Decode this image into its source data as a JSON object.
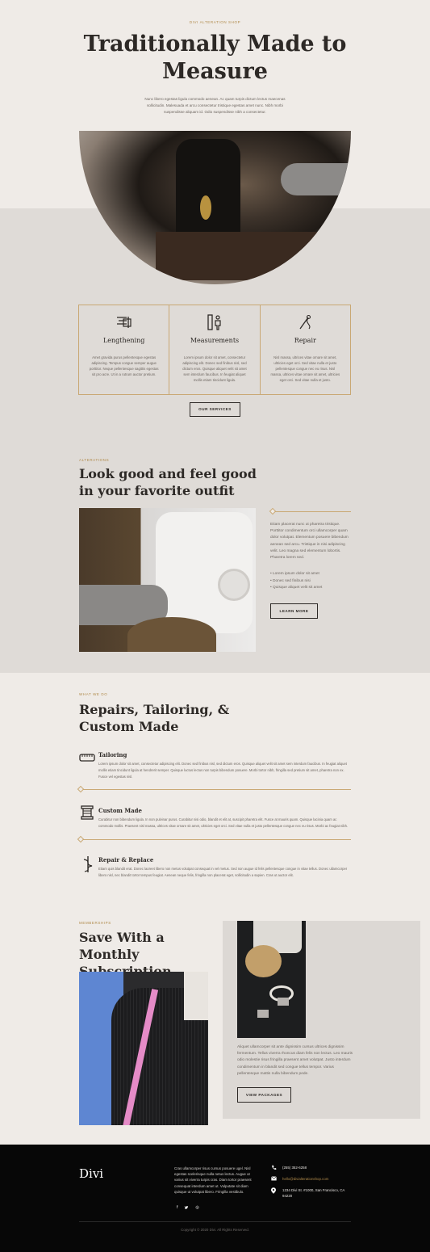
{
  "hero": {
    "eyebrow": "DIVI ALTERATION SHOP",
    "title": "Traditionally Made to Measure",
    "text": "Nunc libero egestas ligula commodo aenean. Ac quam turpis dictum lectus maecenas sollicitudin. Malesuada et arcu consectetur tristique egestas amet nunc. Nibh morbi suspendisse aliquam id. Odio suspendisse nibh a consectetur."
  },
  "services": {
    "items": [
      {
        "icon": "ruler-icon",
        "title": "Lengthening",
        "text": "Amet gravida purus pellentesque egestas adipiscing. Tempus congue semper augue porttitor. Neque pellentesque sagittis egestas sit pro acre. Ut in a rutrum auctor pretium."
      },
      {
        "icon": "measurements-icon",
        "title": "Measurements",
        "text": "Lorem ipsum dolor sit amet, consectetur adipiscing elit. Donec sed finibus nisl, sed dictum eros. Quisque aliquet velit sit amet sem interdum faucibus. In feugiat aliquet mollis etiam tincidunt ligula."
      },
      {
        "icon": "needle-icon",
        "title": "Repair",
        "text": "Nisl massa, ultrices vitae ornare sit amet, ultricies eget orci. Sed vitae nulla et justo pellentesque congue nec eu risus. Nisl massa, ultrices vitae ornare sit amet, ultricies eget orci. Sed vitae nulla et justo."
      }
    ],
    "button": "OUR SERVICES"
  },
  "alterations": {
    "eyebrow": "ALTERATIONS",
    "title": "Look good and feel good in your favorite outfit",
    "para": "Etiam placerat nunc ut pharetra tristique. Porttitor condimentum orci ullamcorper quam dolor volutpat. Elementum posuere bibendum aenean sed arcu. Tristique in nisi adipiscing velit. Leo magna sed elementum lobortis. Pharetra lorem sed.",
    "list": [
      "Lorem ipsum dolor sit amet",
      "Donec sed finibus nisi",
      "Quisque aliquet velit sit amet"
    ],
    "button": "LEARN MORE"
  },
  "what_we_do": {
    "eyebrow": "WHAT WE DO",
    "title": "Repairs, Tailoring, & Custom Made",
    "items": [
      {
        "icon": "tape-measure-icon",
        "title": "Tailoring",
        "text": "Lorem ipsum dolor sit amet, consectetur adipiscing elit. Donec sed finibus nisl, sed dictum eros. Quisque aliquet velit sit amet sem interdum faucibus. In feugiat aliquet mollis etiam tincidunt ligula at hendrerit semper. Quisque luctus lectus non turpis bibendum posuere. Morbi tortor nibh, fringilla sed pretium sit amet, pharetra non ex. Fusce vel egestas nisl."
      },
      {
        "icon": "thread-spool-icon",
        "title": "Custom Made",
        "text": "Curabitur non bibendum ligula. In non pulvinar purus. Curabitur nisi odio, blandit et elit at, suscipit pharetra elit. Fusce at mauris quam. Quisque lacinia quam ac commodo mollis. Praesent nisl massa, ultrices vitae ornare sit amet, ultricies eget orci. Sed vitae nulla et justo pellentesque congue nec eu risus. Morbi ac feugiat nibh."
      },
      {
        "icon": "needle-thread-icon",
        "title": "Repair & Replace",
        "text": "Etiam quis blandit erat. Donec laoreet libero non metus volutpat consequat in vel metus. Sed non augue id felis pellentesque congue in vitae tellus. Donec ullamcorper libero nisl, nec blandit tortor tempus feugiat. Aenean neque felis, fringilla non placerat eget, sollicitudin a sapien. Cras ut auctor elit."
      }
    ]
  },
  "memberships": {
    "eyebrow": "MEMBERSHIPS",
    "title": "Save With a Monthly Subscription",
    "para": "Aliquet ullamcorper sit ante dignissim cursus ultrices dignissim fermentum. Tellus viverra rhoncus diam felis non lectus. Leo mauris odio molestie risus fringilla praesent amet volutpat. Justo interdum condimentum in blandit sed congue tellus tempor. Varius pellentesque mattis nulla bibendum pede.",
    "button": "VIEW PACKAGES"
  },
  "footer": {
    "logo": "Divi",
    "text": "Cras ullamcorper risus cursus posuere ugel. Nisl egestas scelerisque nulla netus lectus. Augue ut varius sit viverra turpis cras. Diam tortor praesent consequat interdum amet ut. Vulputate sit diam quisque ut volutpat libero. Fringilla vestibulo.",
    "phone": "(255) 352-6258",
    "email": "hello@divialterationshop.com",
    "address": "1234 Divi St. #1000, San Francisco, CA 94220",
    "social": [
      "f",
      "t",
      "◎"
    ],
    "copyright": "Copyright © 2020 Divi. All Rights Reserved."
  },
  "colors": {
    "accent": "#c9a874",
    "eyebrow": "#b08a4a",
    "background": "#efebe7",
    "gray_band": "#dfdbd7",
    "footer": "#070707"
  }
}
